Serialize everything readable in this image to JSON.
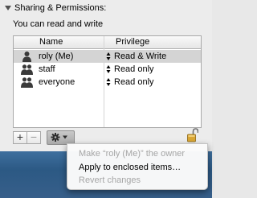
{
  "section": {
    "title": "Sharing & Permissions:"
  },
  "status": {
    "text": "You can read and write"
  },
  "table": {
    "headers": {
      "name": "Name",
      "privilege": "Privilege"
    },
    "rows": [
      {
        "name": "roly (Me)",
        "privilege": "Read & Write",
        "icon": "single-user-icon",
        "selected": true
      },
      {
        "name": "staff",
        "privilege": "Read only",
        "icon": "group-icon",
        "selected": false
      },
      {
        "name": "everyone",
        "privilege": "Read only",
        "icon": "group-icon",
        "selected": false
      }
    ]
  },
  "toolbar": {
    "add_label": "+",
    "remove_label": "−"
  },
  "menu": {
    "items": [
      {
        "label": "Make “roly (Me)” the owner",
        "enabled": false
      },
      {
        "label": "Apply to enclosed items…",
        "enabled": true
      },
      {
        "label": "Revert changes",
        "enabled": false
      }
    ]
  },
  "colors": {
    "selection": "#d4d4d4",
    "desktop": "#2c5984",
    "disabled_text": "#a6a6a6"
  }
}
